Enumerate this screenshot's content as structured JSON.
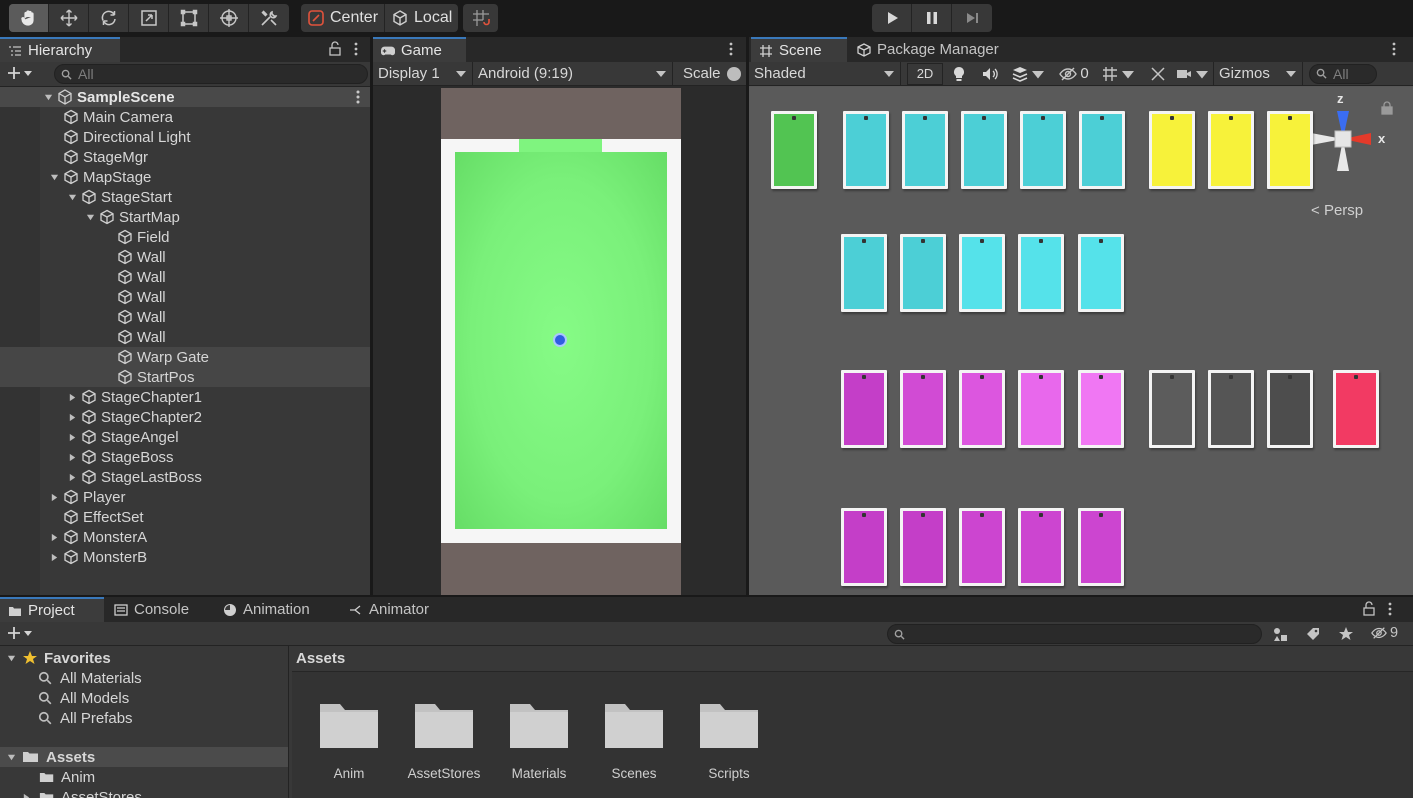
{
  "toolbar": {
    "tools": [
      "hand-tool",
      "move-tool",
      "rotate-tool",
      "scale-tool",
      "rect-tool",
      "transform-tool",
      "custom-tool"
    ],
    "pivot_label": "Center",
    "space_label": "Local",
    "play": [
      "play",
      "pause",
      "step"
    ]
  },
  "hierarchy": {
    "tab_label": "Hierarchy",
    "search_placeholder": "All",
    "scene_name": "SampleScene",
    "rows": [
      {
        "label": "Main Camera",
        "depth": 1,
        "fold": "none"
      },
      {
        "label": "Directional Light",
        "depth": 1,
        "fold": "none"
      },
      {
        "label": "StageMgr",
        "depth": 1,
        "fold": "none"
      },
      {
        "label": "MapStage",
        "depth": 1,
        "fold": "open"
      },
      {
        "label": "StageStart",
        "depth": 2,
        "fold": "open"
      },
      {
        "label": "StartMap",
        "depth": 3,
        "fold": "open"
      },
      {
        "label": "Field",
        "depth": 4,
        "fold": "none"
      },
      {
        "label": "Wall",
        "depth": 4,
        "fold": "none"
      },
      {
        "label": "Wall",
        "depth": 4,
        "fold": "none"
      },
      {
        "label": "Wall",
        "depth": 4,
        "fold": "none"
      },
      {
        "label": "Wall",
        "depth": 4,
        "fold": "none"
      },
      {
        "label": "Wall",
        "depth": 4,
        "fold": "none"
      },
      {
        "label": "Warp Gate",
        "depth": 4,
        "fold": "none",
        "selected": true
      },
      {
        "label": "StartPos",
        "depth": 4,
        "fold": "none",
        "selected": true
      },
      {
        "label": "StageChapter1",
        "depth": 2,
        "fold": "closed"
      },
      {
        "label": "StageChapter2",
        "depth": 2,
        "fold": "closed"
      },
      {
        "label": "StageAngel",
        "depth": 2,
        "fold": "closed"
      },
      {
        "label": "StageBoss",
        "depth": 2,
        "fold": "closed"
      },
      {
        "label": "StageLastBoss",
        "depth": 2,
        "fold": "closed"
      },
      {
        "label": "Player",
        "depth": 1,
        "fold": "closed"
      },
      {
        "label": "EffectSet",
        "depth": 1,
        "fold": "none"
      },
      {
        "label": "MonsterA",
        "depth": 1,
        "fold": "closed"
      },
      {
        "label": "MonsterB",
        "depth": 1,
        "fold": "closed"
      }
    ]
  },
  "game": {
    "tab_label": "Game",
    "display": "Display 1",
    "aspect": "Android (9:19)",
    "scale_label": "Scale",
    "colors": {
      "field": "#7ff47f",
      "field_edge": "#5ed95e",
      "wall": "#f6f6f6",
      "backdrop": "#6f6360",
      "player": "#2f5fe0"
    }
  },
  "scene": {
    "tab_label": "Scene",
    "pkg_tab_label": "Package Manager",
    "shading": "Shaded",
    "mode_2d": "2D",
    "hidden_count": "0",
    "gizmos_label": "Gizmos",
    "search_placeholder": "All",
    "persp_label": "Persp",
    "axis_z": "z",
    "axis_x": "x",
    "stage_rows": [
      [
        "#52c452",
        "#4ccfd6",
        "#4ccfd6",
        "#4ccfd6",
        "#4ccfd6",
        "#4ccfd6",
        "#f7f23a",
        "#f7f23a",
        "#f7f23a"
      ],
      [
        "#4ccfd6",
        "#4ccfd6",
        "#55e2ea",
        "#55e2ea",
        "#55e2ea"
      ],
      [
        "#c43ec8",
        "#d14bd4",
        "#dc56df",
        "#e868ec",
        "#f077f3",
        "#5c5c5c",
        "#555555",
        "#4d4d4d",
        "#f23a63"
      ],
      [
        "#c43ec8",
        "#c43ec8",
        "#cc45d0",
        "#cc45d0",
        "#cc45d0"
      ]
    ]
  },
  "project": {
    "tabs": [
      "Project",
      "Console",
      "Animation",
      "Animator"
    ],
    "hidden_count": "9",
    "favorites_label": "Favorites",
    "favorites": [
      "All Materials",
      "All Models",
      "All Prefabs"
    ],
    "assets_label": "Assets",
    "asset_children": [
      "Anim",
      "AssetStores"
    ],
    "crumb": "Assets",
    "folders": [
      "Anim",
      "AssetStores",
      "Materials",
      "Scenes",
      "Scripts"
    ]
  }
}
